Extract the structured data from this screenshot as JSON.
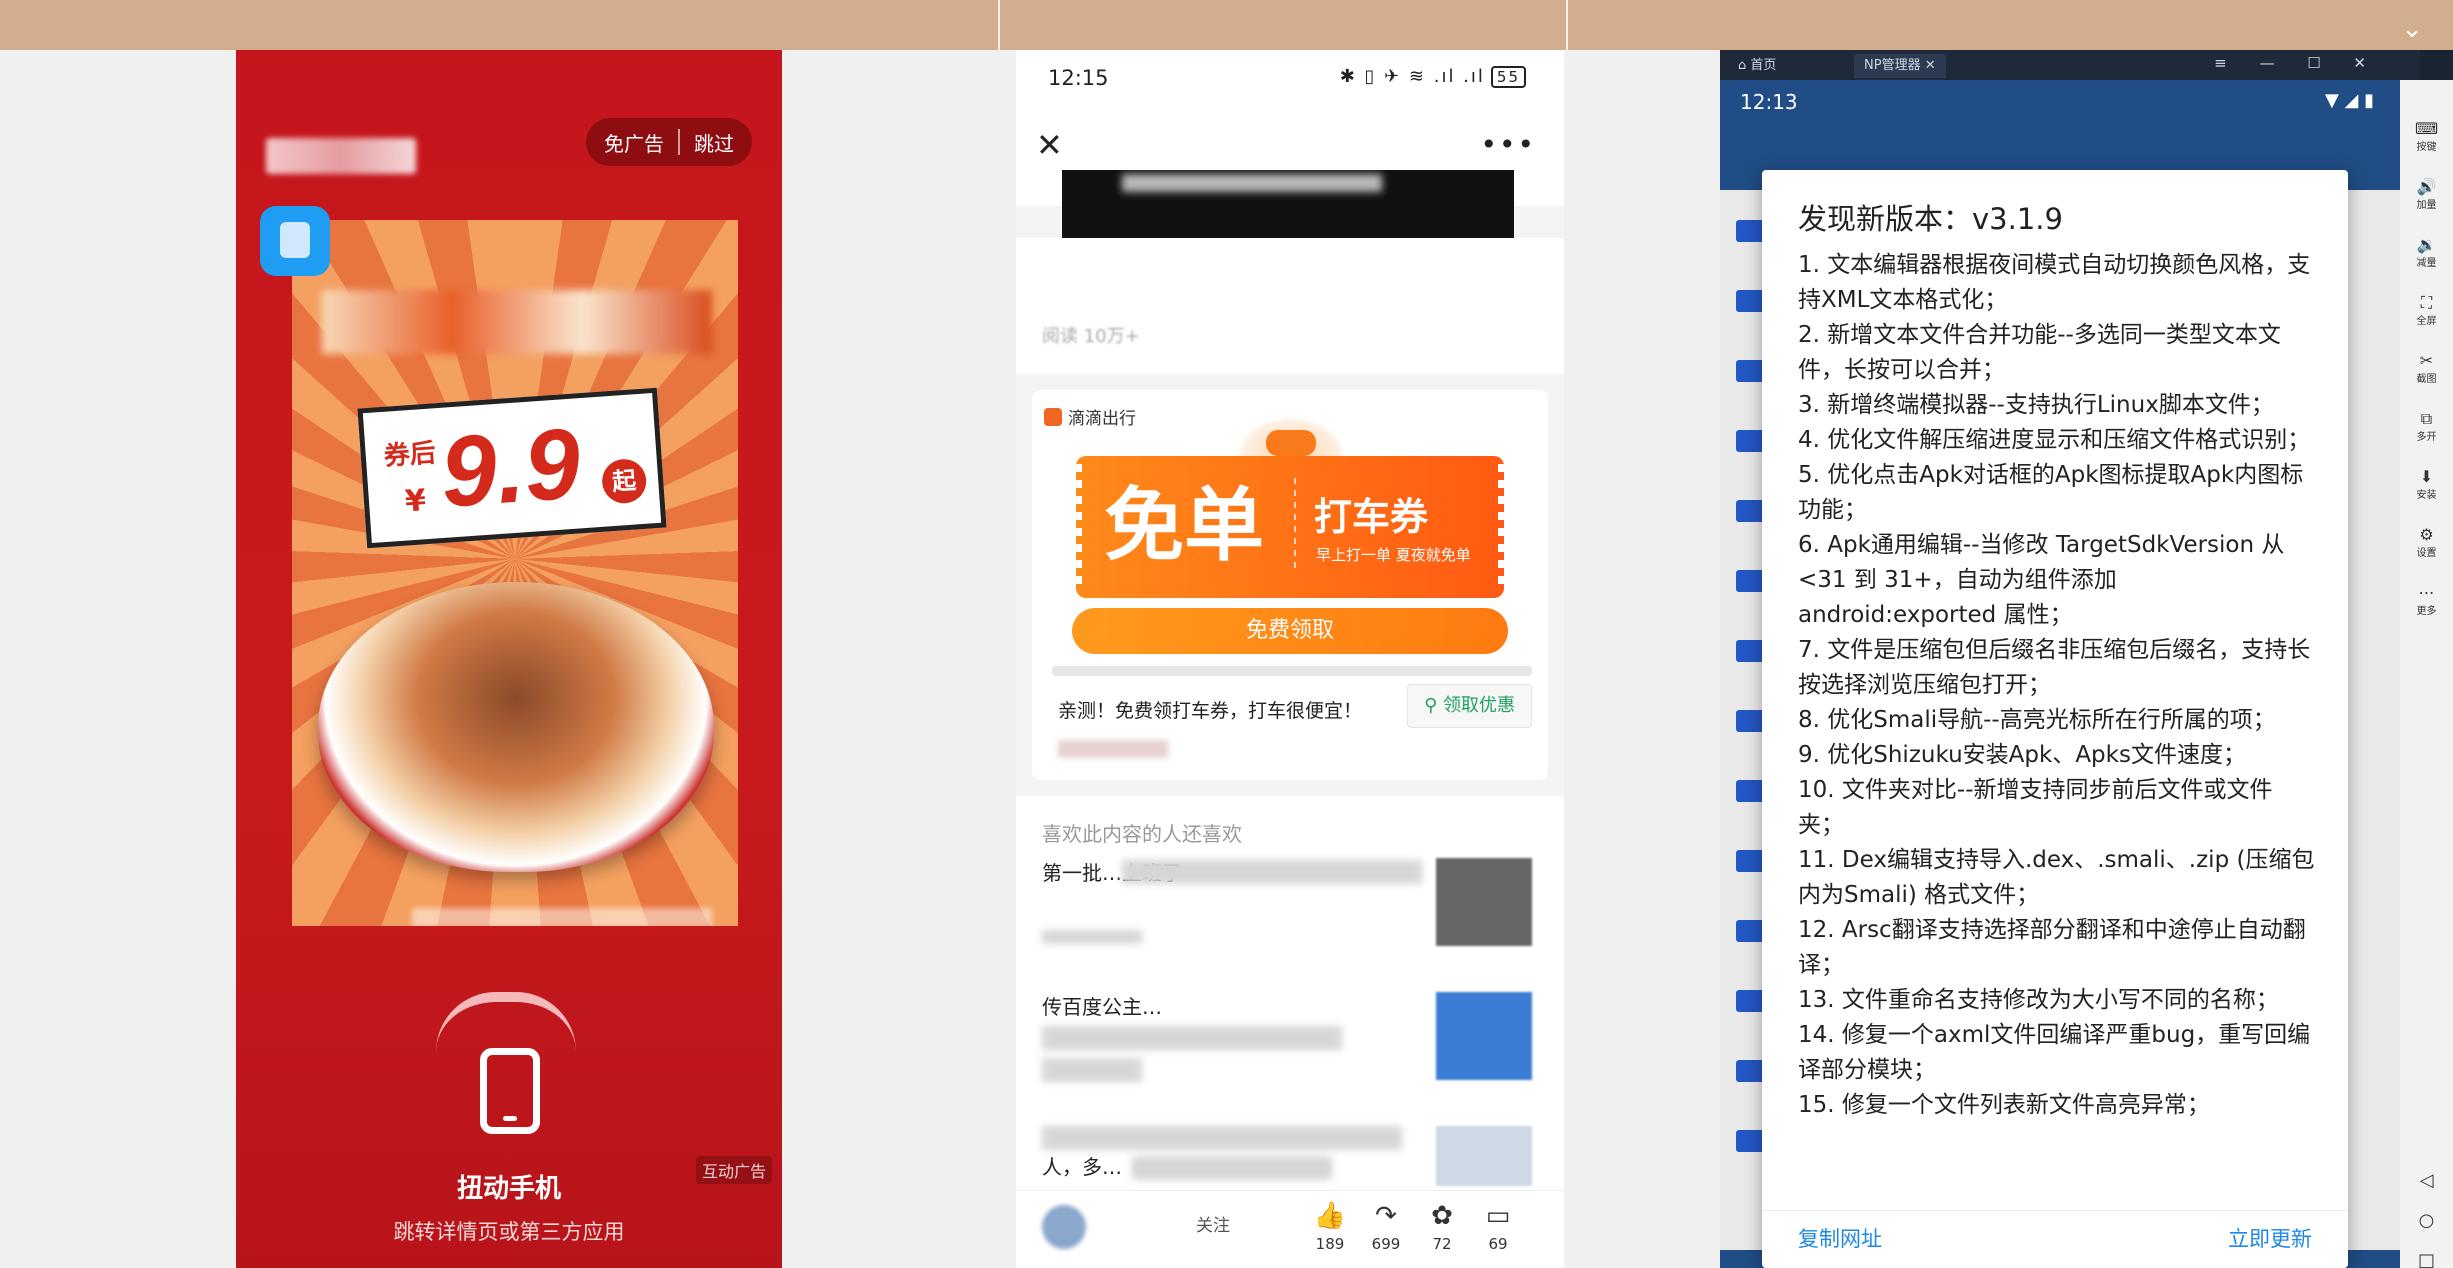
{
  "colors": {
    "topband": "#d2ad8e",
    "ad_red": "#c4161c",
    "ticket_orange": "#ff6a14",
    "link_blue": "#1e88e5",
    "claim_green": "#21a161"
  },
  "ad": {
    "no_ads_label": "免广告",
    "skip_label": "跳过",
    "price_prefix": "券后",
    "price_yen": "¥",
    "price_number": "9.9",
    "price_suffix": "起",
    "twist_title": "扭动手机",
    "twist_subtitle": "跳转详情页或第三方应用",
    "tag": "互动广告"
  },
  "article": {
    "status_time": "12:15",
    "status_icons": "✱ ▯ ✈ ≋ .ıl .ıl",
    "battery": "55",
    "reads": "阅读 10万+",
    "ad_card": {
      "brand": "滴滴出行",
      "ticket_big": "免单",
      "ticket_title": "打车券",
      "ticket_subtitle": "早上打一单 夏夜就免单",
      "claim_button": "免费领取",
      "description": "亲测！免费领打车券，打车很便宜！",
      "get_offer_button": "领取优惠"
    },
    "related_header": "喜欢此内容的人还喜欢",
    "related": [
      {
        "title": "第一批…上班了"
      },
      {
        "title": "传百度公主…"
      },
      {
        "title": "人，多…"
      }
    ],
    "bottom_bar": {
      "follow_label": "关注",
      "actions": [
        {
          "icon": "thumb-up-icon",
          "glyph": "👍",
          "count": "189"
        },
        {
          "icon": "share-icon",
          "glyph": "↷",
          "count": "699"
        },
        {
          "icon": "star-icon",
          "glyph": "✿",
          "count": "72"
        },
        {
          "icon": "comment-icon",
          "glyph": "▭",
          "count": "69"
        }
      ]
    }
  },
  "emulator": {
    "tab_home": "首页",
    "tab_active": "NP管理器",
    "status_time": "12:13",
    "dialog": {
      "title": "发现新版本：v3.1.9",
      "items": [
        "1. 文本编辑器根据夜间模式自动切换颜色风格，支持XML文本格式化；",
        "2. 新增文本文件合并功能--多选同一类型文本文件，长按可以合并；",
        "3. 新增终端模拟器--支持执行Linux脚本文件；",
        "4. 优化文件解压缩进度显示和压缩文件格式识别；",
        "5. 优化点击Apk对话框的Apk图标提取Apk内图标功能；",
        "6. Apk通用编辑--当修改 TargetSdkVersion 从 <31 到 31+，自动为组件添加 android:exported 属性；",
        "7. 文件是压缩包但后缀名非压缩包后缀名，支持长按选择浏览压缩包打开；",
        "8. 优化Smali导航--高亮光标所在行所属的项；",
        "9. 优化Shizuku安装Apk、Apks文件速度；",
        "10. 文件夹对比--新增支持同步前后文件或文件夹；",
        "11. Dex编辑支持导入.dex、.smali、.zip (压缩包内为Smali) 格式文件；",
        "12. Arsc翻译支持选择部分翻译和中途停止自动翻译；",
        "13. 文件重命名支持修改为大小写不同的名称；",
        "14. 修复一个axml文件回编译严重bug，重写回编译部分模块；",
        "15. 修复一个文件列表新文件高亮异常；"
      ],
      "copy_button": "复制网址",
      "update_button": "立即更新"
    },
    "rail": [
      {
        "icon": "keyboard-icon",
        "glyph": "⌨",
        "label": "按键"
      },
      {
        "icon": "volume-up-icon",
        "glyph": "🔊",
        "label": "加量"
      },
      {
        "icon": "volume-down-icon",
        "glyph": "🔉",
        "label": "减量"
      },
      {
        "icon": "fullscreen-icon",
        "glyph": "⛶",
        "label": "全屏"
      },
      {
        "icon": "screenshot-icon",
        "glyph": "✂",
        "label": "截图"
      },
      {
        "icon": "multi-open-icon",
        "glyph": "⧉",
        "label": "多开"
      },
      {
        "icon": "install-icon",
        "glyph": "⬇",
        "label": "安装"
      },
      {
        "icon": "settings-icon",
        "glyph": "⚙",
        "label": "设置"
      },
      {
        "icon": "more-icon",
        "glyph": "⋯",
        "label": "更多"
      }
    ]
  }
}
